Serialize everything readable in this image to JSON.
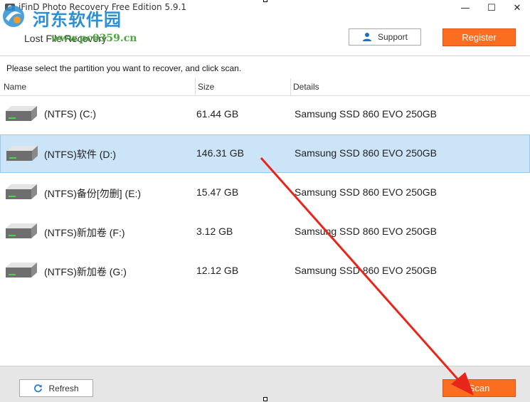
{
  "window": {
    "title": "iFinD Photo Recovery Free Edition 5.9.1",
    "minimize_glyph": "—",
    "maximize_glyph": "☐",
    "close_glyph": "✕"
  },
  "watermark": {
    "site_name": "河东软件园",
    "url": "www.pc0359.cn"
  },
  "header": {
    "title": "Lost File Recovery",
    "support_label": "Support",
    "register_label": "Register",
    "support_icon": "user-icon"
  },
  "instruction": "Please select the partition you want to recover, and click scan.",
  "columns": {
    "name": "Name",
    "size": "Size",
    "details": "Details"
  },
  "partitions": [
    {
      "name": "(NTFS) (C:)",
      "size": "61.44 GB",
      "details": "Samsung SSD 860 EVO 250GB",
      "selected": false
    },
    {
      "name": "(NTFS)软件 (D:)",
      "size": "146.31 GB",
      "details": "Samsung SSD 860 EVO 250GB",
      "selected": true
    },
    {
      "name": "(NTFS)备份[勿删] (E:)",
      "size": "15.47 GB",
      "details": "Samsung SSD 860 EVO 250GB",
      "selected": false
    },
    {
      "name": "(NTFS)新加卷 (F:)",
      "size": "3.12 GB",
      "details": "Samsung SSD 860 EVO 250GB",
      "selected": false
    },
    {
      "name": "(NTFS)新加卷 (G:)",
      "size": "12.12 GB",
      "details": "Samsung SSD 860 EVO 250GB",
      "selected": false
    }
  ],
  "footer": {
    "refresh_label": "Refresh",
    "scan_label": "Scan",
    "refresh_icon": "refresh-icon"
  },
  "colors": {
    "accent_orange": "#fb6d1f",
    "selection_blue": "#cce4f7",
    "annotation_red": "#e8251b"
  }
}
